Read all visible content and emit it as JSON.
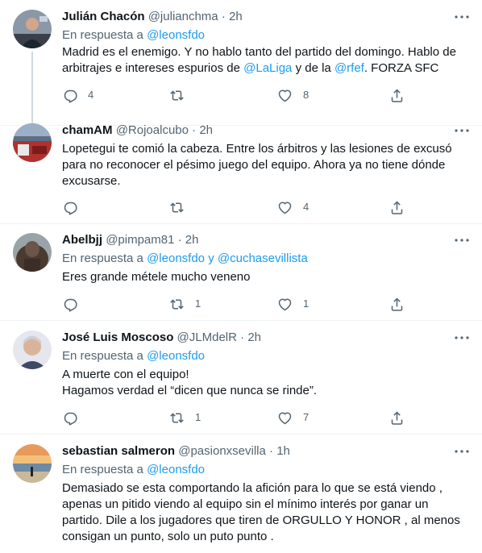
{
  "colors": {
    "text": "#0f1419",
    "secondary": "#536471",
    "link": "#1d9bf0",
    "divider": "#eff3f4",
    "thread_line": "#cfd9de"
  },
  "icons": {
    "more": "more-dots-icon",
    "reply": "reply-icon",
    "retweet": "retweet-icon",
    "like": "heart-icon",
    "share": "share-icon"
  },
  "tweets": [
    {
      "name": "Julián Chacón",
      "handle": "@julianchma",
      "time": "2h",
      "reply_to_prefix": "En respuesta a",
      "reply_to": [
        "@leonsfdo"
      ],
      "body": [
        [
          {
            "t": "Madrid es el enemigo. Y no hablo tanto del partido del domingo. Hablo de"
          }
        ],
        [
          {
            "t": "arbitrajes e intereses espurios de "
          },
          {
            "t": "@LaLiga",
            "link": true
          },
          {
            "t": " y de la "
          },
          {
            "t": "@rfef",
            "link": true
          },
          {
            "t": ". FORZA SFC"
          }
        ]
      ],
      "replies": "4",
      "retweets": "",
      "likes": "8"
    },
    {
      "name": "chamAM",
      "handle": "@Rojoalcubo",
      "time": "2h",
      "reply_to_prefix": "",
      "reply_to": [],
      "body": [
        [
          {
            "t": "Lopetegui te comió la cabeza. Entre los árbitros y las lesiones de excusó"
          }
        ],
        [
          {
            "t": "para no reconocer el pésimo juego del equipo. Ahora ya no tiene dónde"
          }
        ],
        [
          {
            "t": "excusarse."
          }
        ]
      ],
      "replies": "",
      "retweets": "",
      "likes": "4"
    },
    {
      "name": "Abelbjj",
      "handle": "@pimpam81",
      "time": "2h",
      "reply_to_prefix": "En respuesta a",
      "reply_to": [
        "@leonsfdo",
        "@cuchasevillista"
      ],
      "reply_to_joiner": " y ",
      "body": [
        [
          {
            "t": "Eres grande  métele mucho  veneno"
          }
        ]
      ],
      "replies": "",
      "retweets": "1",
      "likes": "1"
    },
    {
      "name": "José Luis Moscoso",
      "handle": "@JLMdelR",
      "time": "2h",
      "reply_to_prefix": "En respuesta a",
      "reply_to": [
        "@leonsfdo"
      ],
      "body": [
        [
          {
            "t": "A muerte con el equipo!"
          }
        ],
        [
          {
            "t": "Hagamos verdad el “dicen que nunca se rinde”."
          }
        ]
      ],
      "replies": "",
      "retweets": "1",
      "likes": "7"
    },
    {
      "name": "sebastian salmeron",
      "handle": "@pasionxsevilla",
      "time": "1h",
      "reply_to_prefix": "En respuesta a",
      "reply_to": [
        "@leonsfdo"
      ],
      "body": [
        [
          {
            "t": "Demasiado se esta comportando la afición para lo que se está viendo ,"
          }
        ],
        [
          {
            "t": "apenas un pitido viendo al equipo sin el mínimo interés por ganar un"
          }
        ],
        [
          {
            "t": "partido. Dile a los jugadores que tiren de ORGULLO Y HONOR , al menos"
          }
        ],
        [
          {
            "t": "consigan un punto,  solo un puto punto ."
          }
        ]
      ],
      "replies": "",
      "retweets": "",
      "likes": ""
    }
  ]
}
